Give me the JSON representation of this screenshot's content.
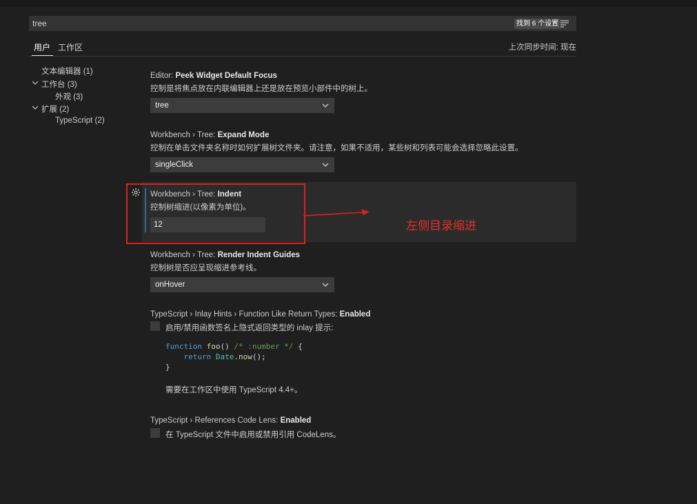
{
  "search": {
    "value": "tree",
    "results_badge": "找到 6 个设置"
  },
  "tabs": [
    {
      "label": "用户"
    },
    {
      "label": "工作区"
    }
  ],
  "sync_status": "上次同步时间: 现在",
  "toc": [
    {
      "label": "文本编辑器 (1)"
    },
    {
      "label": "工作台 (3)"
    },
    {
      "label": "外观 (3)"
    },
    {
      "label": "扩展 (2)"
    },
    {
      "label": "TypeScript (2)"
    }
  ],
  "settings": [
    {
      "category": "Editor: ",
      "name": "Peek Widget Default Focus",
      "description": "控制是将焦点放在内联编辑器上还是放在预览小部件中的树上。",
      "value": "tree"
    },
    {
      "category": "Workbench › Tree: ",
      "name": "Expand Mode",
      "description": "控制在单击文件夹名称时如何扩展树文件夹。请注意，如果不适用，某些树和列表可能会选择忽略此设置。",
      "value": "singleClick"
    },
    {
      "category": "Workbench › Tree: ",
      "name": "Indent",
      "description": "控制树缩进(以像素为单位)。",
      "value": "12"
    },
    {
      "category": "Workbench › Tree: ",
      "name": "Render Indent Guides",
      "description": "控制树是否应呈现缩进参考线。",
      "value": "onHover"
    },
    {
      "category": "TypeScript › Inlay Hints › Function Like Return Types: ",
      "name": "Enabled",
      "description": "启用/禁用函数签名上隐式返回类型的 inlay 提示:",
      "note": "需要在工作区中使用 TypeScript 4.4+。"
    },
    {
      "category": "TypeScript › References Code Lens: ",
      "name": "Enabled",
      "description": "在 TypeScript 文件中启用或禁用引用 CodeLens。"
    }
  ],
  "code": {
    "kw_function": "function",
    "fn_name": "foo",
    "parens": "() ",
    "comment": "/* :number */",
    "brace_open": " {",
    "kw_return": "return",
    "type_name": "Date",
    "dot": ".",
    "method": "now",
    "call_end": "();",
    "brace_close": "}"
  },
  "annotation": {
    "text": "左侧目录缩进",
    "color": "#e0302a"
  },
  "colors": {
    "background": "#1f1f1f",
    "input": "#3c3c3c",
    "highlight": "#e02020",
    "focus_bar": "#2a6f8a"
  }
}
